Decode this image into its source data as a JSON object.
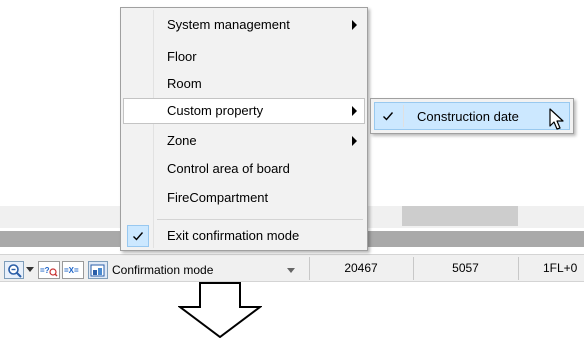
{
  "context_menu": {
    "items": [
      {
        "label": "System management",
        "has_submenu": true
      },
      {
        "label": "Floor",
        "has_submenu": false
      },
      {
        "label": "Room",
        "has_submenu": false
      },
      {
        "label": "Custom property",
        "has_submenu": true,
        "highlighted": true
      },
      {
        "label": "Zone",
        "has_submenu": true
      },
      {
        "label": "Control area of board",
        "has_submenu": false
      },
      {
        "label": "FireCompartment",
        "has_submenu": false
      }
    ],
    "checked_item": {
      "label": "Exit confirmation mode",
      "checked": true
    }
  },
  "submenu": {
    "item": {
      "label": "Construction date",
      "checked": true
    }
  },
  "status_bar": {
    "toolbar_icons": [
      "zoom-icon",
      "dropdown-arrow-icon",
      "query-icon",
      "cross-icon",
      "picture-icon"
    ],
    "mode_label": "Confirmation mode",
    "fields": [
      "20467",
      "5057",
      "1FL+0"
    ]
  },
  "colors": {
    "highlight": "#cce8ff",
    "menu_bg": "#f2f2f2",
    "statusbar_bg": "#f0f0f0"
  }
}
